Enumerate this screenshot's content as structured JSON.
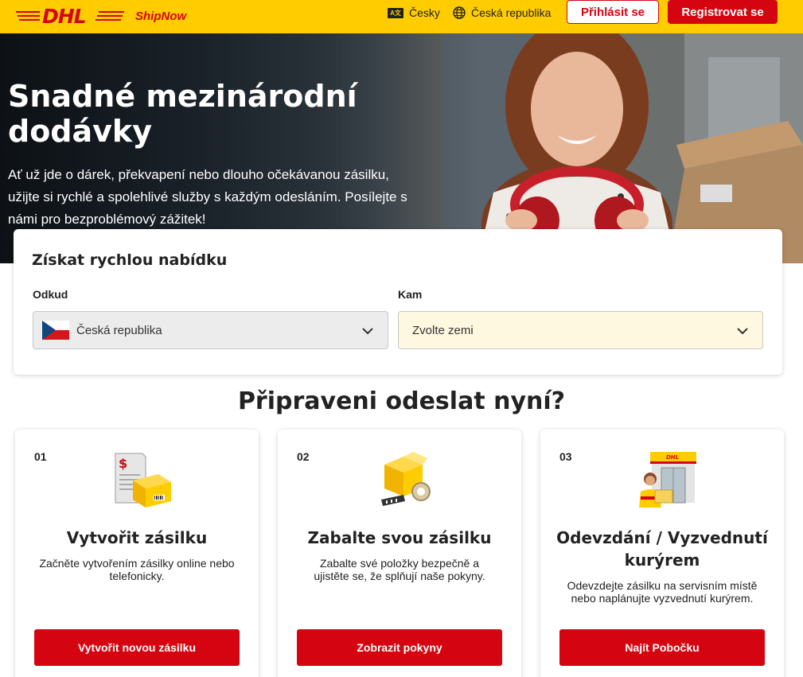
{
  "header": {
    "logo": "DHL",
    "product": "ShipNow",
    "language": "Česky",
    "country": "Česká republika",
    "login_label": "Přihlásit se",
    "register_label": "Registrovat se",
    "brand_yellow": "#ffcc00",
    "brand_red": "#d40511"
  },
  "hero": {
    "title": "Snadné mezinárodní dodávky",
    "text": "Ať už jde o dárek, překvapení nebo dlouho očekávanou zásilku, užijte si rychlé a spolehlivé služby s každým odesláním. Posílejte s námi pro bezproblémový zážitek!"
  },
  "quote": {
    "title": "Získat rychlou nabídku",
    "from_label": "Odkud",
    "from_value": "Česká republika",
    "to_label": "Kam",
    "to_placeholder": "Zvolte zemi"
  },
  "section_title": "Připraveni odeslat nyní?",
  "steps": [
    {
      "number": "01",
      "title": "Vytvořit zásilku",
      "description": "Začněte vytvořením zásilky online nebo telefonicky.",
      "button": "Vytvořit novou zásilku",
      "icon": "shipment-document-icon"
    },
    {
      "number": "02",
      "title": "Zabalte svou zásilku",
      "description": "Zabalte své položky bezpečně a ujistěte se, že splňují naše pokyny.",
      "button": "Zobrazit pokyny",
      "icon": "package-tape-icon"
    },
    {
      "number": "03",
      "title": "Odevzdání / Vyzvednutí kurýrem",
      "description": "Odevzdejte zásilku na servisním místě nebo naplánujte vyzvednutí kurýrem.",
      "button": "Najít Pobočku",
      "icon": "courier-servicepoint-icon"
    }
  ]
}
